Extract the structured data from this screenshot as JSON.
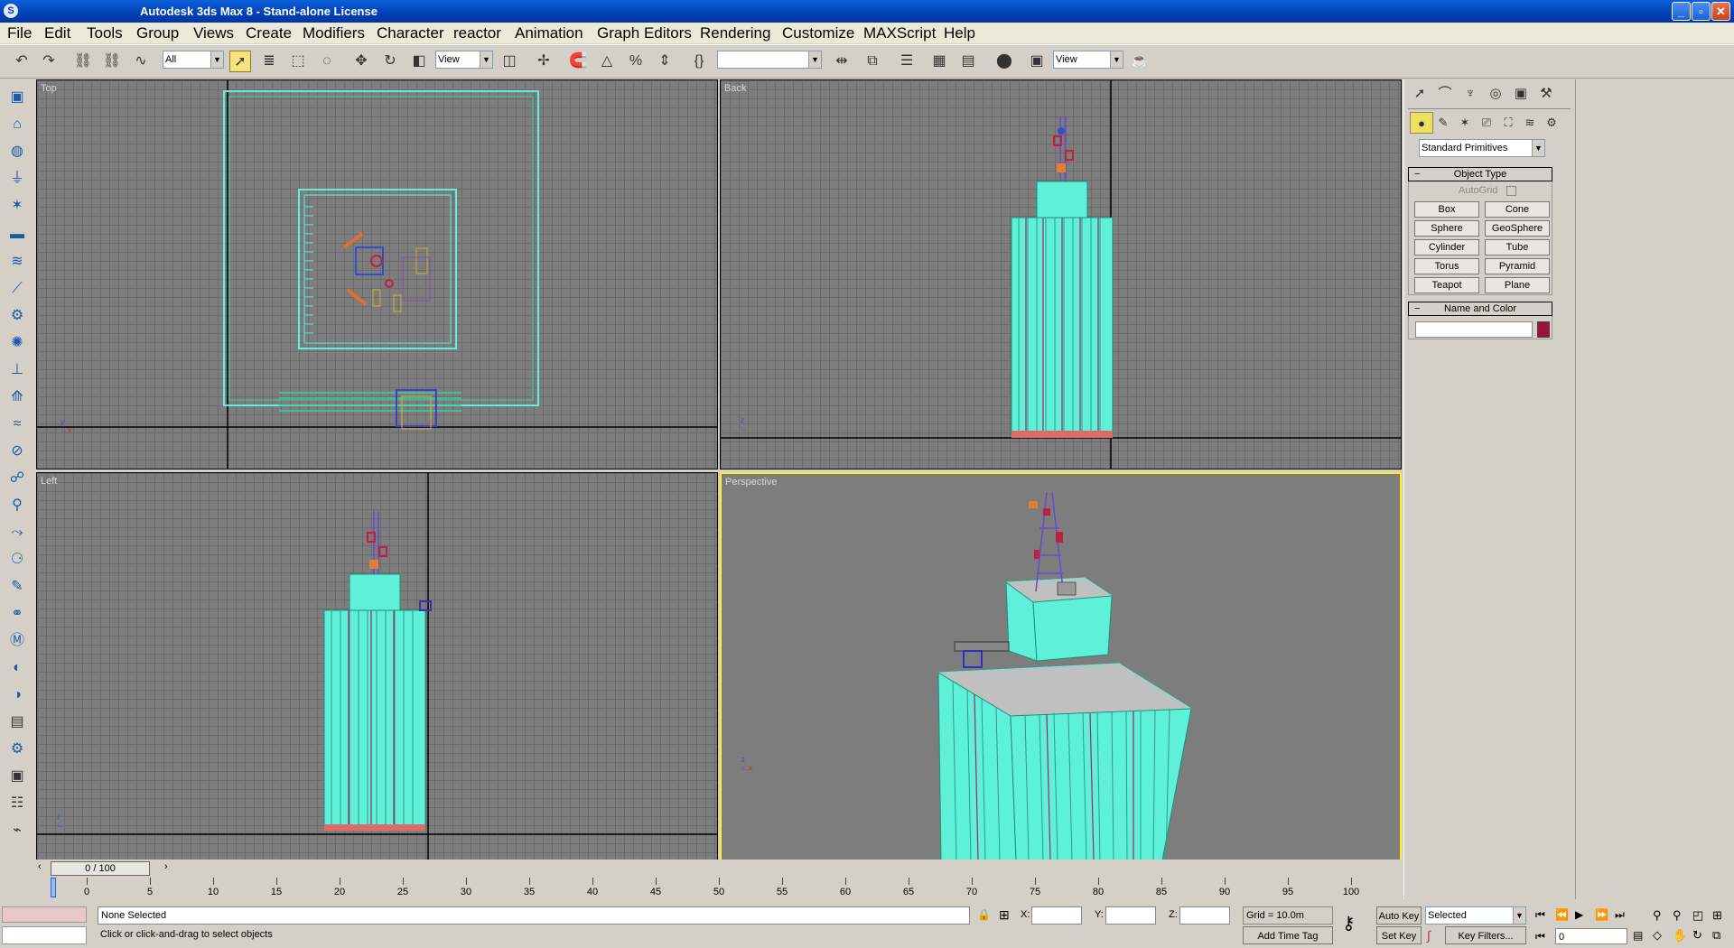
{
  "app": {
    "title": "Autodesk 3ds Max 8  - Stand-alone License",
    "window_buttons": [
      "minimize-icon",
      "restore-icon",
      "close-icon"
    ]
  },
  "menu": [
    "File",
    "Edit",
    "Tools",
    "Group",
    "Views",
    "Create",
    "Modifiers",
    "Character",
    "reactor",
    "Animation",
    "Graph Editors",
    "Rendering",
    "Customize",
    "MAXScript",
    "Help"
  ],
  "toolbar": {
    "selection_filter": "All",
    "ref_coord_system": "View",
    "named_selection_set": "",
    "render_view": "View"
  },
  "viewports": {
    "top": "Top",
    "back": "Back",
    "left": "Left",
    "perspective": "Perspective"
  },
  "timeslider": {
    "frame": "0 / 100",
    "ticks": [
      "0",
      "5",
      "10",
      "15",
      "20",
      "25",
      "30",
      "35",
      "40",
      "45",
      "50",
      "55",
      "60",
      "65",
      "70",
      "75",
      "80",
      "85",
      "90",
      "95",
      "100"
    ]
  },
  "status": {
    "selection": "None Selected",
    "prompt": "Click or click-and-drag to select objects",
    "x_label": "X:",
    "y_label": "Y:",
    "z_label": "Z:",
    "x_value": "",
    "y_value": "",
    "z_value": "",
    "grid": "Grid = 10.0m",
    "add_time_tag": "Add Time Tag",
    "auto_key": "Auto Key",
    "set_key": "Set Key",
    "key_mode": "Selected",
    "key_filters": "Key Filters...",
    "current_frame": "0"
  },
  "command_panel": {
    "category": "Standard Primitives",
    "object_type": "Object Type",
    "autogrid": "AutoGrid",
    "buttons": [
      "Box",
      "Cone",
      "Sphere",
      "GeoSphere",
      "Cylinder",
      "Tube",
      "Torus",
      "Pyramid",
      "Teapot",
      "Plane"
    ],
    "name_and_color": "Name and Color",
    "object_name": "",
    "object_color": "#a0103c"
  },
  "colors": {
    "title_bar": "#0040b8",
    "wire_cyan": "#5ff0d8",
    "active_viewport_border": "#ffee20",
    "viewport_bg": "#7d7d7d"
  }
}
